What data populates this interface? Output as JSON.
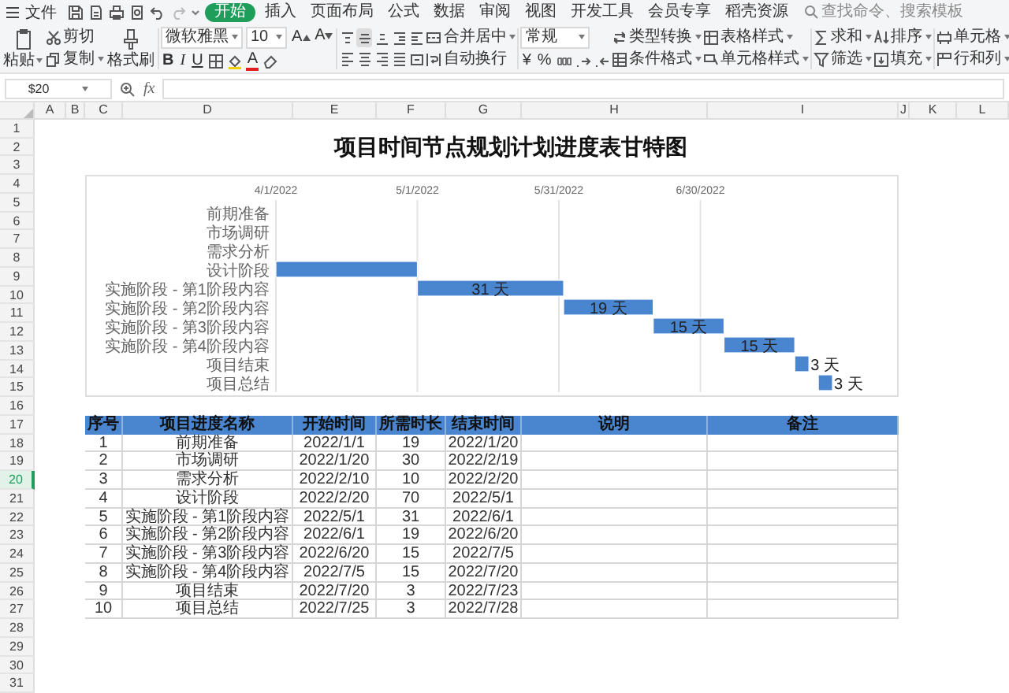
{
  "menu_bar": {
    "file": "文件",
    "tabs": [
      {
        "label": "开始",
        "selected": true
      },
      {
        "label": "插入",
        "selected": false
      },
      {
        "label": "页面布局",
        "selected": false
      },
      {
        "label": "公式",
        "selected": false
      },
      {
        "label": "数据",
        "selected": false
      },
      {
        "label": "审阅",
        "selected": false
      },
      {
        "label": "视图",
        "selected": false
      },
      {
        "label": "开发工具",
        "selected": false
      },
      {
        "label": "会员专享",
        "selected": false
      },
      {
        "label": "稻壳资源",
        "selected": false
      }
    ],
    "search": {
      "placeholder": "查找命令、搜索模板"
    }
  },
  "ribbon": {
    "paste": "粘贴",
    "cut": "剪切",
    "copy": "复制",
    "format_painter": "格式刷",
    "font": "微软雅黑",
    "font_size": "10",
    "size_buttons": [
      "A",
      "A"
    ],
    "format_buttons": [
      "B",
      "I",
      "U"
    ],
    "font_color": "A",
    "align_buttons": [
      {
        "selected": false
      },
      {
        "selected": true
      },
      {
        "selected": false
      },
      {
        "selected": false
      },
      {
        "selected": false
      },
      {
        "selected": false
      },
      {
        "selected": false
      },
      {
        "selected": false
      },
      {
        "selected": false
      },
      {
        "selected": false
      }
    ],
    "merge": "合并居中",
    "wrap": "自动换行",
    "number_format": "常规",
    "number_buttons": [
      "¥",
      "%"
    ],
    "convert": "类型转换",
    "conditional": "条件格式",
    "table_style": "表格样式",
    "cell_style": "单元格样式",
    "sum": "求和",
    "filter": "筛选",
    "sort": "排序",
    "fill": "填充",
    "cells": "单元格",
    "rows_cols": "行和列"
  },
  "formula_bar": {
    "name_box": "$20",
    "fx": "fx"
  },
  "columns": [
    "A",
    "B",
    "C",
    "D",
    "E",
    "F",
    "G",
    "H",
    "I",
    "J",
    "K",
    "L"
  ],
  "rows": [
    {
      "label": "1",
      "selected": false
    },
    {
      "label": "2",
      "selected": false
    },
    {
      "label": "3",
      "selected": false
    },
    {
      "label": "4",
      "selected": false
    },
    {
      "label": "5",
      "selected": false
    },
    {
      "label": "6",
      "selected": false
    },
    {
      "label": "7",
      "selected": false
    },
    {
      "label": "8",
      "selected": false
    },
    {
      "label": "9",
      "selected": false
    },
    {
      "label": "10",
      "selected": false
    },
    {
      "label": "11",
      "selected": false
    },
    {
      "label": "12",
      "selected": false
    },
    {
      "label": "13",
      "selected": false
    },
    {
      "label": "14",
      "selected": false
    },
    {
      "label": "15",
      "selected": false
    },
    {
      "label": "16",
      "selected": false
    },
    {
      "label": "17",
      "selected": false
    },
    {
      "label": "18",
      "selected": false
    },
    {
      "label": "19",
      "selected": false
    },
    {
      "label": "20",
      "selected": true
    },
    {
      "label": "21",
      "selected": false
    },
    {
      "label": "22",
      "selected": false
    },
    {
      "label": "23",
      "selected": false
    },
    {
      "label": "24",
      "selected": false
    },
    {
      "label": "25",
      "selected": false
    },
    {
      "label": "26",
      "selected": false
    },
    {
      "label": "27",
      "selected": false
    },
    {
      "label": "28",
      "selected": false
    },
    {
      "label": "29",
      "selected": false
    },
    {
      "label": "30",
      "selected": false
    },
    {
      "label": "31",
      "selected": false
    }
  ],
  "sheet": {
    "title": "项目时间节点规划计划进度表甘特图",
    "chart": {
      "categories": [
        "前期准备",
        "市场调研",
        "需求分析",
        "设计阶段",
        "实施阶段 - 第1阶段内容",
        "实施阶段 - 第2阶段内容",
        "实施阶段 - 第3阶段内容",
        "实施阶段 - 第4阶段内容",
        "项目结束",
        "项目总结"
      ],
      "bar_labels": [
        "31 天",
        "19 天",
        "15 天",
        "15 天",
        "3 天",
        "3 天"
      ],
      "date_labels": [
        "4/1/2022",
        "5/1/2022",
        "5/31/2022",
        "6/30/2022"
      ]
    },
    "table": {
      "columns": [
        "序号",
        "项目进度名称",
        "开始时间",
        "所需时长",
        "结束时间",
        "说明",
        "备注"
      ],
      "rows": [
        [
          "1",
          "前期准备",
          "2022/1/1",
          "19",
          "2022/1/20"
        ],
        [
          "2",
          "市场调研",
          "2022/1/20",
          "30",
          "2022/2/19"
        ],
        [
          "3",
          "需求分析",
          "2022/2/10",
          "10",
          "2022/2/20"
        ],
        [
          "4",
          "设计阶段",
          "2022/2/20",
          "70",
          "2022/5/1"
        ],
        [
          "5",
          "实施阶段 - 第1阶段内容",
          "2022/5/1",
          "31",
          "2022/6/1"
        ],
        [
          "6",
          "实施阶段 - 第2阶段内容",
          "2022/6/1",
          "19",
          "2022/6/20"
        ],
        [
          "7",
          "实施阶段 - 第3阶段内容",
          "2022/6/20",
          "15",
          "2022/7/5"
        ],
        [
          "8",
          "实施阶段 - 第4阶段内容",
          "2022/7/5",
          "15",
          "2022/7/20"
        ],
        [
          "9",
          "项目结束",
          "2022/7/20",
          "3",
          "2022/7/23"
        ],
        [
          "10",
          "项目总结",
          "2022/7/25",
          "3",
          "2022/7/28"
        ]
      ]
    }
  }
}
